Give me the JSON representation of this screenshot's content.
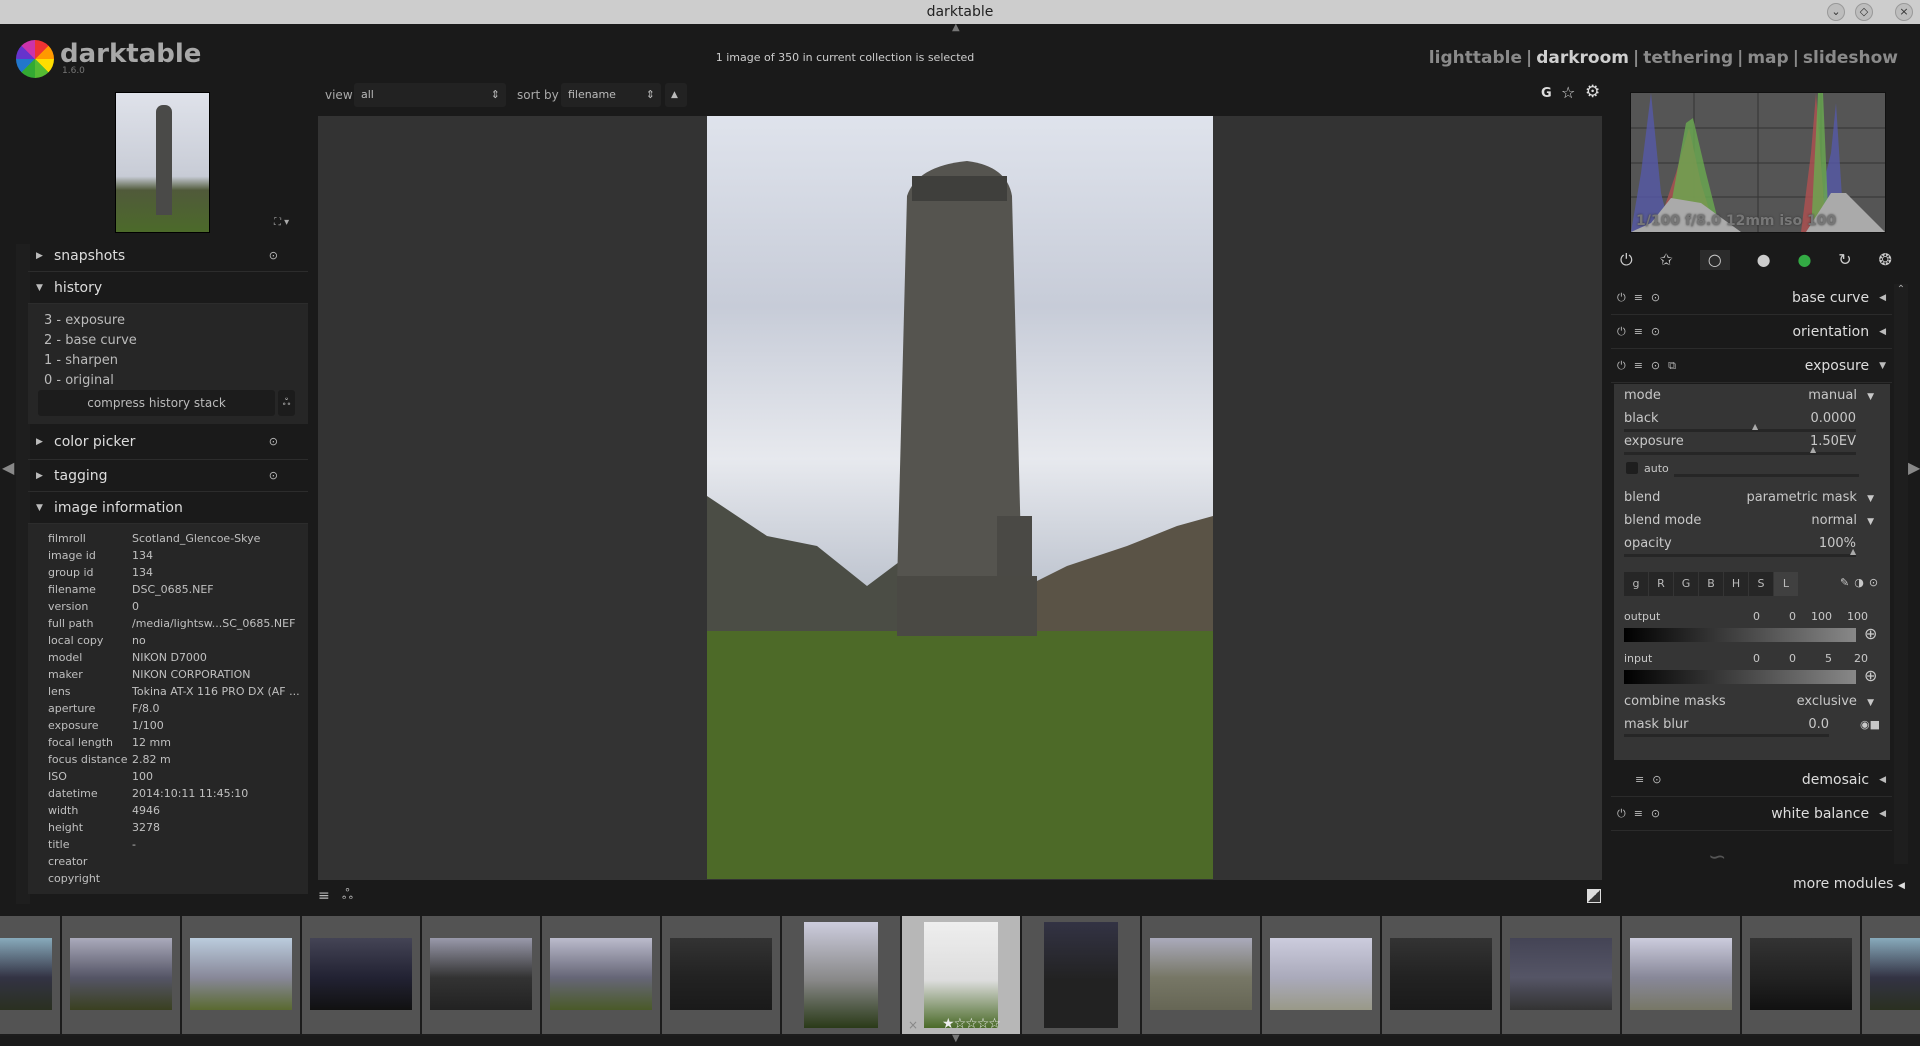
{
  "window": {
    "title": "darktable"
  },
  "app": {
    "name": "darktable",
    "version": "1.6.0"
  },
  "status": "1 image of 350 in current collection is selected",
  "views": [
    {
      "label": "lighttable",
      "active": false
    },
    {
      "label": "darkroom",
      "active": true
    },
    {
      "label": "tethering",
      "active": false
    },
    {
      "label": "map",
      "active": false
    },
    {
      "label": "slideshow",
      "active": false
    }
  ],
  "toolbar": {
    "view_label": "view",
    "view_value": "all",
    "sort_label": "sort by",
    "sort_value": "filename",
    "g_label": "G"
  },
  "left": {
    "snapshots": "snapshots",
    "history": {
      "title": "history",
      "items": [
        "3 - exposure",
        "2 - base curve",
        "1 - sharpen",
        "0 - original"
      ],
      "compress": "compress history stack"
    },
    "color_picker": "color picker",
    "tagging": "tagging",
    "image_information": {
      "title": "image information",
      "rows": [
        {
          "k": "filmroll",
          "v": "Scotland_Glencoe-Skye"
        },
        {
          "k": "image id",
          "v": "134"
        },
        {
          "k": "group id",
          "v": "134"
        },
        {
          "k": "filename",
          "v": "DSC_0685.NEF"
        },
        {
          "k": "version",
          "v": "0"
        },
        {
          "k": "full path",
          "v": "/media/lightsw...SC_0685.NEF"
        },
        {
          "k": "local copy",
          "v": "no"
        },
        {
          "k": "model",
          "v": "NIKON D7000"
        },
        {
          "k": "maker",
          "v": "NIKON CORPORATION"
        },
        {
          "k": "lens",
          "v": "Tokina AT-X 116 PRO DX (AF ..."
        },
        {
          "k": "aperture",
          "v": "F/8.0"
        },
        {
          "k": "exposure",
          "v": "1/100"
        },
        {
          "k": "focal length",
          "v": "12 mm"
        },
        {
          "k": "focus distance",
          "v": "2.82 m"
        },
        {
          "k": "ISO",
          "v": "100"
        },
        {
          "k": "datetime",
          "v": "2014:10:11 11:45:10"
        },
        {
          "k": "width",
          "v": "4946"
        },
        {
          "k": "height",
          "v": "3278"
        },
        {
          "k": "title",
          "v": "-"
        },
        {
          "k": "creator",
          "v": ""
        },
        {
          "k": "copyright",
          "v": ""
        }
      ]
    }
  },
  "histogram": {
    "overlay": "1/100 f/8.0 12mm iso 100"
  },
  "right": {
    "modules": {
      "base_curve": "base curve",
      "orientation": "orientation",
      "exposure": "exposure",
      "demosaic": "demosaic",
      "white_balance": "white balance"
    },
    "exposure": {
      "mode_label": "mode",
      "mode_value": "manual",
      "black_label": "black",
      "black_value": "0.0000",
      "black_pos": 0.5,
      "exposure_label": "exposure",
      "exposure_value": "1.50EV",
      "exposure_pos": 0.72,
      "auto_label": "auto",
      "blend_label": "blend",
      "blend_value": "parametric mask",
      "blend_mode_label": "blend mode",
      "blend_mode_value": "normal",
      "opacity_label": "opacity",
      "opacity_value": "100%",
      "channel_tabs": [
        "g",
        "R",
        "G",
        "B",
        "H",
        "S",
        "L"
      ],
      "active_tab": "L",
      "output_label": "output",
      "output_values": [
        "0",
        "0",
        "100",
        "100"
      ],
      "input_label": "input",
      "input_values": [
        "0",
        "0",
        "5",
        "20"
      ],
      "combine_label": "combine masks",
      "combine_value": "exclusive",
      "mask_blur_label": "mask blur",
      "mask_blur_value": "0.0"
    },
    "more_modules": "more modules"
  },
  "filmstrip": {
    "selected_rating": 1,
    "max_rating": 5
  }
}
